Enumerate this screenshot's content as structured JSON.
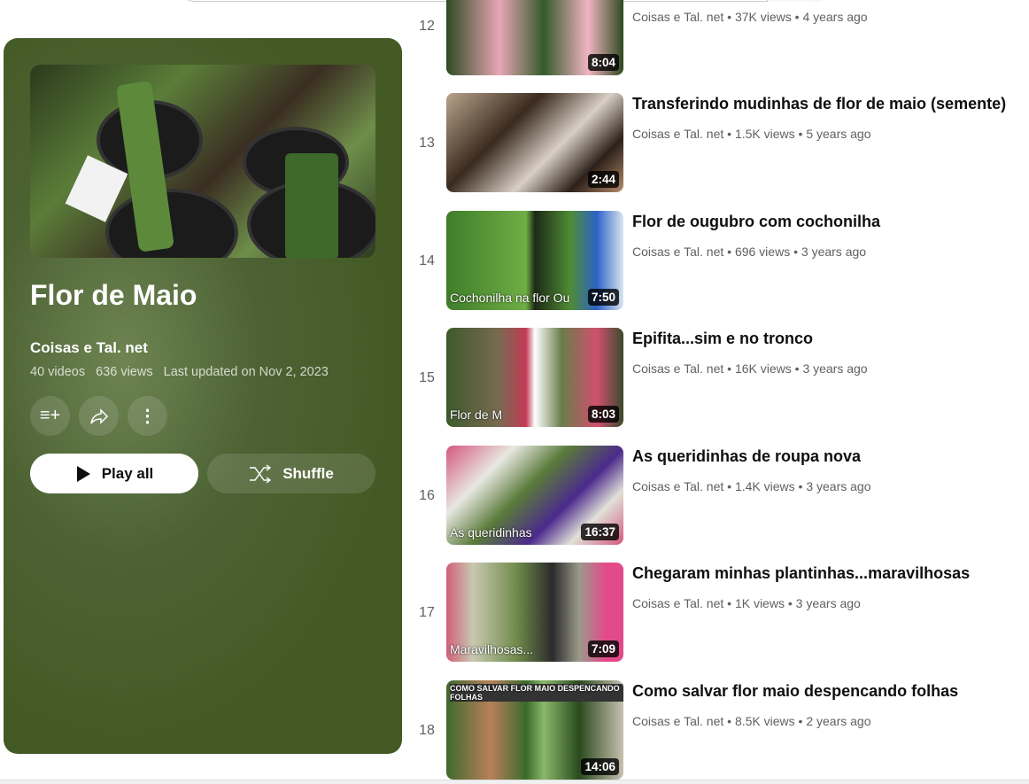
{
  "playlist": {
    "title": "Flor de Maio",
    "owner": "Coisas e Tal. net",
    "video_count": "40 videos",
    "views": "636 views",
    "updated": "Last updated on Nov 2, 2023",
    "play_all": "Play all",
    "shuffle": "Shuffle"
  },
  "colors": {
    "panel": "#445a25",
    "accent": "#ffffff"
  },
  "videos": [
    {
      "index": "12",
      "title": "",
      "channel": "Coisas e Tal. net",
      "views": "37K views",
      "age": "4 years ago",
      "duration": "8:04",
      "overlay": "",
      "bg": "linear-gradient(90deg,#2f4a22,#e7a7b5 30%,#355a2a 55%,#f0b4c2 80%,#2d4a20)"
    },
    {
      "index": "13",
      "title": "Transferindo mudinhas de flor de maio (semente)",
      "channel": "Coisas e Tal. net",
      "views": "1.5K views",
      "age": "5 years ago",
      "duration": "2:44",
      "overlay": "",
      "bg": "linear-gradient(135deg,#b9a48c,#3a2a1f 35%,#d8cfc5 60%,#2c2119 80%,#b58a6c)"
    },
    {
      "index": "14",
      "title": "Flor de ougubro com cochonilha",
      "channel": "Coisas e Tal. net",
      "views": "696 views",
      "age": "3 years ago",
      "duration": "7:50",
      "overlay": "Cochonilha na flor Ou",
      "bg": "linear-gradient(90deg,#3f7d2a,#6fae45 45%,#1d2a16 50%,#4f8c35 70%,#2d63c8 85%,#d9e6f0)"
    },
    {
      "index": "15",
      "title": "Epifita...sim e no tronco",
      "channel": "Coisas e Tal. net",
      "views": "16K views",
      "age": "3 years ago",
      "duration": "8:03",
      "overlay": "Flor de M",
      "bg": "linear-gradient(90deg,#3d5a2c,#7a6a52 30%,#c23a55 45%,#fff 50%,#6a7d4a 65%,#d0506f 85%,#3a4a2c)"
    },
    {
      "index": "16",
      "title": "As queridinhas de roupa nova",
      "channel": "Coisas e Tal. net",
      "views": "1.4K views",
      "age": "3 years ago",
      "duration": "16:37",
      "overlay": "As queridinhas",
      "bg": "linear-gradient(135deg,#d4577f,#e8e8e0 25%,#5a7a3a 45%,#4b2a8c 65%,#e0e0d8 80%,#d4577f)"
    },
    {
      "index": "17",
      "title": "Chegaram minhas plantinhas...maravilhosas",
      "channel": "Coisas e Tal. net",
      "views": "1K views",
      "age": "3 years ago",
      "duration": "7:09",
      "overlay": "Maravilhosas...",
      "bg": "linear-gradient(90deg,#d0607a,#c8c8b0 15%,#6e8a4a 40%,#2b2b2b 60%,#9a9a8a 75%,#e34a8a 90%)"
    },
    {
      "index": "18",
      "title": "Como salvar flor maio despencando folhas",
      "channel": "Coisas e Tal. net",
      "views": "8.5K views",
      "age": "2 years ago",
      "duration": "14:06",
      "overlay_top": "COMO SALVAR FLOR MAIO DESPENCANDO FOLHAS",
      "bg": "linear-gradient(90deg,#3f6a2c,#b8805a 25%,#3a6a2c 45%,#8ab86a 55%,#2a4a1e 75%,#c8c0b0)"
    }
  ]
}
